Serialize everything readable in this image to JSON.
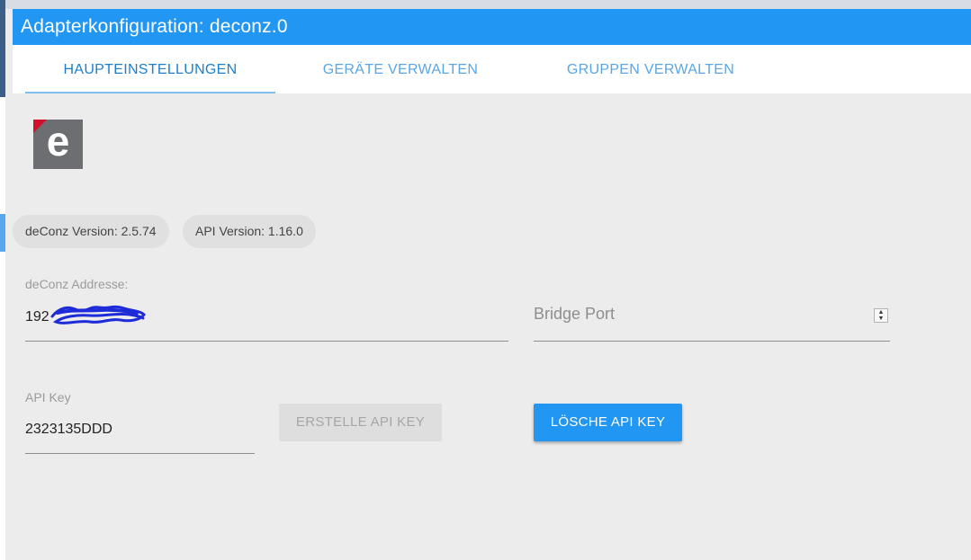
{
  "window": {
    "title": "Adapterkonfiguration: deconz.0"
  },
  "tabs": [
    {
      "label": "HAUPTEINSTELLUNGEN",
      "active": true
    },
    {
      "label": "GERÄTE VERWALTEN",
      "active": false
    },
    {
      "label": "GRUPPEN VERWALTEN",
      "active": false
    }
  ],
  "logo": {
    "letter": "e",
    "icon": "deconz-logo-icon"
  },
  "chips": {
    "deconz_version": "deConz Version: 2.5.74",
    "api_version": "API Version: 1.16.0"
  },
  "fields": {
    "address": {
      "label": "deConz Addresse:",
      "value": "192"
    },
    "bridge_port": {
      "placeholder": "Bridge Port",
      "value": ""
    },
    "api_key": {
      "label": "API Key",
      "value": "2323135DDD"
    }
  },
  "buttons": {
    "create_api_key": "ERSTELLE API KEY",
    "delete_api_key": "LÖSCHE API KEY"
  },
  "colors": {
    "accent": "#2196f3",
    "background": "#ececec",
    "logo_bg": "#6d6e72",
    "logo_corner": "#d0102a"
  }
}
